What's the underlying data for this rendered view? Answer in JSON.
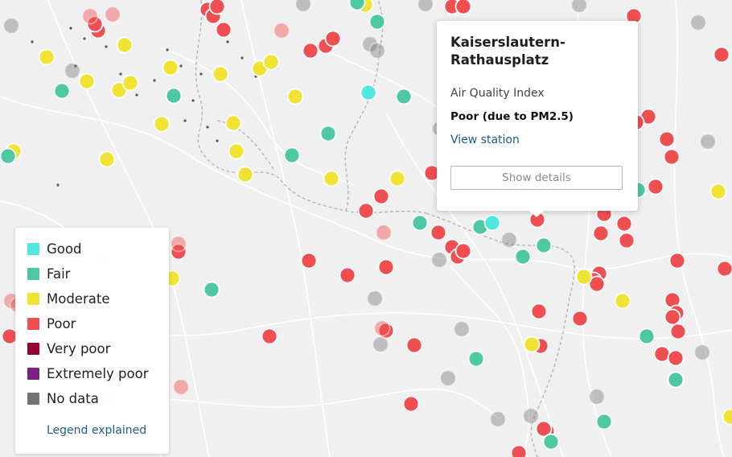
{
  "colors": {
    "good": "#4fe8e0",
    "fair": "#4ec7a3",
    "moderate": "#f0e333",
    "poor": "#f04f52",
    "very_poor": "#960032",
    "extremely_poor": "#7d2181",
    "no_data": "#737373",
    "map_background": "#f0f0f0",
    "link": "#1a5e8a"
  },
  "legend": {
    "items": [
      {
        "key": "good",
        "label": "Good"
      },
      {
        "key": "fair",
        "label": "Fair"
      },
      {
        "key": "moderate",
        "label": "Moderate"
      },
      {
        "key": "poor",
        "label": "Poor"
      },
      {
        "key": "very_poor",
        "label": "Very poor"
      },
      {
        "key": "extremely_poor",
        "label": "Extremely poor"
      },
      {
        "key": "no_data",
        "label": "No data"
      }
    ],
    "link_label": "Legend explained"
  },
  "popup": {
    "title": "Kaiserslautern-Rathausplatz",
    "subtitle": "Air Quality Index",
    "status": "Poor (due to PM2.5)",
    "link_label": "View station",
    "button_label": "Show details"
  }
}
